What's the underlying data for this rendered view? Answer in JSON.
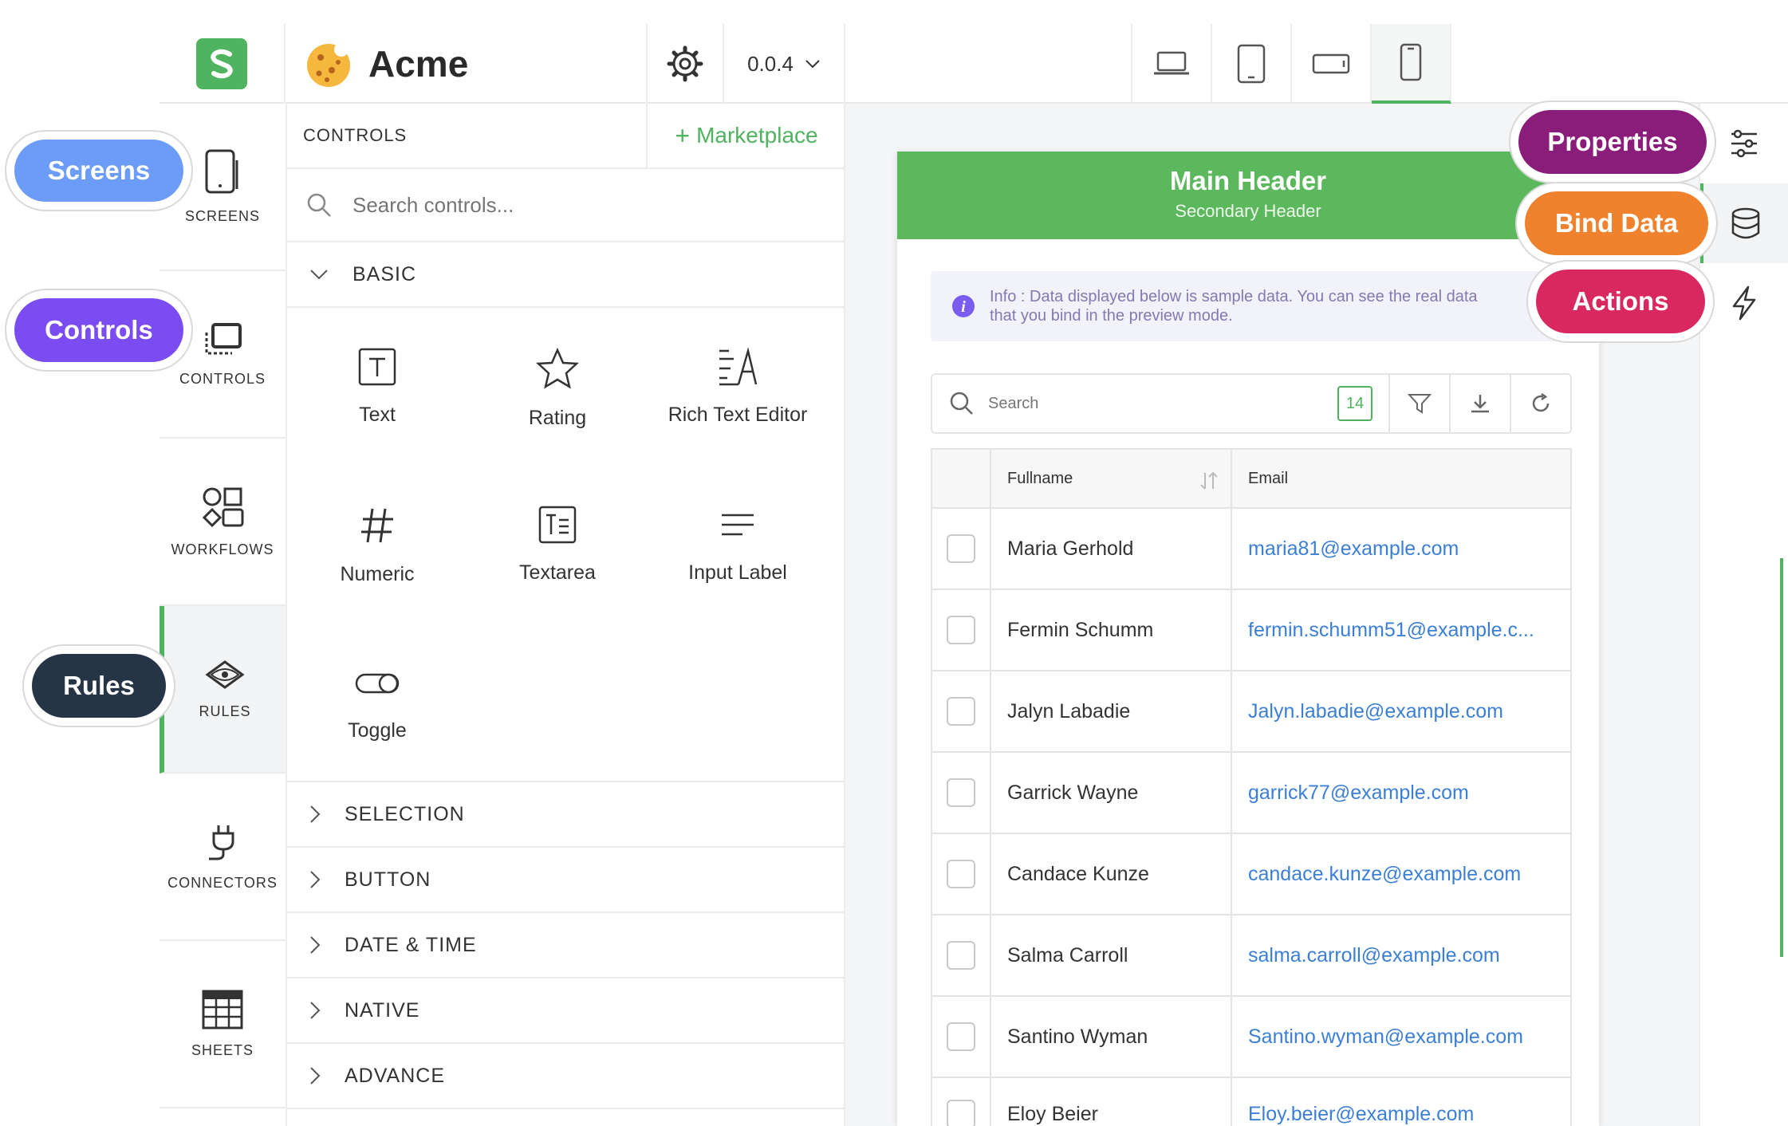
{
  "app": {
    "name": "Acme",
    "version": "0.0.4"
  },
  "nav": [
    {
      "id": "screens",
      "label": "SCREENS"
    },
    {
      "id": "controls",
      "label": "CONTROLS"
    },
    {
      "id": "workflows",
      "label": "WORKFLOWS"
    },
    {
      "id": "rules",
      "label": "RULES"
    },
    {
      "id": "connectors",
      "label": "CONNECTORS"
    },
    {
      "id": "sheets",
      "label": "SHEETS"
    }
  ],
  "controls": {
    "title": "CONTROLS",
    "marketplace": "Marketplace",
    "search_placeholder": "Search controls...",
    "basic": "BASIC",
    "tools": [
      "Text",
      "Rating",
      "Rich Text Editor",
      "Numeric",
      "Textarea",
      "Input Label",
      "Toggle"
    ],
    "sections": [
      "SELECTION",
      "BUTTON",
      "DATE & TIME",
      "NATIVE",
      "ADVANCE"
    ]
  },
  "preview": {
    "main_header": "Main Header",
    "secondary_header": "Secondary Header",
    "info_line1": "Info : Data displayed below is sample data. You can see the real data",
    "info_line2": "that you bind in the preview mode.",
    "search_placeholder": "Search",
    "count": "14",
    "columns": [
      "Fullname",
      "Email"
    ],
    "rows": [
      [
        "Maria Gerhold",
        "maria81@example.com"
      ],
      [
        "Fermin Schumm",
        "fermin.schumm51@example.c..."
      ],
      [
        "Jalyn Labadie",
        "Jalyn.labadie@example.com"
      ],
      [
        "Garrick Wayne",
        "garrick77@example.com"
      ],
      [
        "Candace Kunze",
        "candace.kunze@example.com"
      ],
      [
        "Salma Carroll",
        "salma.carroll@example.com"
      ],
      [
        "Santino Wyman",
        "Santino.wyman@example.com"
      ],
      [
        "Eloy Beier",
        "Eloy.beier@example.com"
      ]
    ]
  },
  "callouts": {
    "screens": "Screens",
    "controls": "Controls",
    "rules": "Rules",
    "properties": "Properties",
    "bind_data": "Bind Data",
    "actions": "Actions"
  },
  "colors": {
    "accent": "#4fb35f",
    "screens_pill": "#6b9cf7",
    "controls_pill": "#7a4cf2",
    "rules_pill": "#263545",
    "properties_pill": "#8b1d7a",
    "binddata_pill": "#f0822e",
    "actions_pill": "#d8285f",
    "link": "#3b7fd6"
  }
}
